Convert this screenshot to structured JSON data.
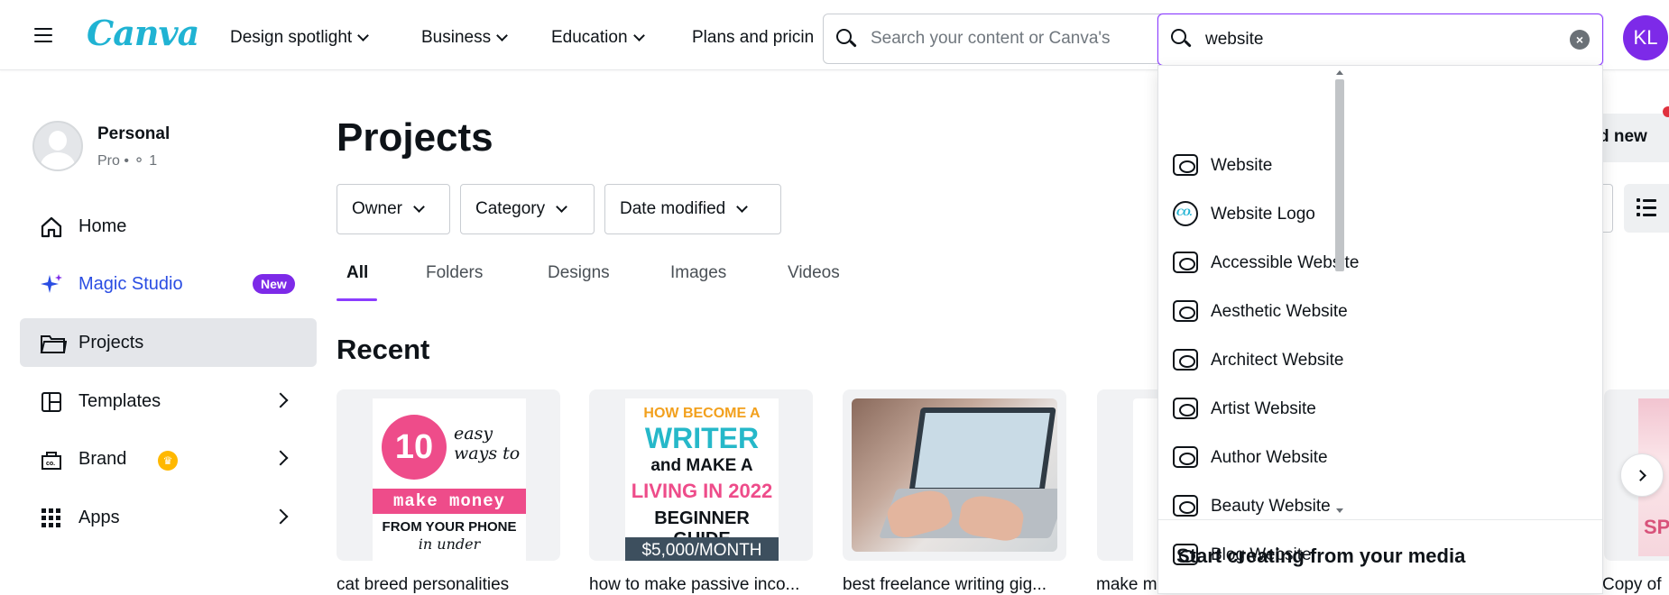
{
  "header": {
    "logo": "Canva",
    "nav": [
      {
        "label": "Design spotlight"
      },
      {
        "label": "Business"
      },
      {
        "label": "Education"
      },
      {
        "label": "Plans and pricin"
      }
    ],
    "search_placeholder": "Search your content or Canva's",
    "search_value": "website",
    "avatar_initials": "KL"
  },
  "sidebar": {
    "account_name": "Personal",
    "account_plan": "Pro • ",
    "account_members": "1",
    "items": [
      {
        "label": "Home",
        "icon": "home-icon"
      },
      {
        "label": "Magic Studio",
        "icon": "sparkle-icon",
        "badge": "New"
      },
      {
        "label": "Projects",
        "icon": "folder-icon",
        "active": true
      },
      {
        "label": "Templates",
        "icon": "templates-icon"
      },
      {
        "label": "Brand",
        "icon": "brand-icon"
      },
      {
        "label": "Apps",
        "icon": "apps-grid-icon"
      }
    ]
  },
  "main": {
    "title": "Projects",
    "filters": [
      {
        "label": "Owner"
      },
      {
        "label": "Category"
      },
      {
        "label": "Date modified"
      }
    ],
    "tabs": [
      {
        "label": "All",
        "active": true
      },
      {
        "label": "Folders"
      },
      {
        "label": "Designs"
      },
      {
        "label": "Images"
      },
      {
        "label": "Videos"
      }
    ],
    "section_title": "Recent",
    "cards": [
      {
        "title": "cat breed personalities",
        "thumb": {
          "num": "10",
          "script": "easy ways to",
          "bar": "make money",
          "line": "FROM YOUR PHONE",
          "under": "in under"
        }
      },
      {
        "title": "how to make passive inco...",
        "thumb": {
          "l1": "HOW BECOME A",
          "l2": "WRITER",
          "l3": "and MAKE A",
          "l4": "LIVING IN 2022",
          "l5": "BEGINNER GUIDE",
          "bar": "$5,000/MONTH"
        }
      },
      {
        "title": "best freelance writing gig..."
      },
      {
        "title": "make m"
      },
      {
        "title": "Copy of",
        "thumb_text": "SP"
      }
    ],
    "add_new_label": "d new"
  },
  "dropdown": {
    "suggestions": [
      {
        "label": "Website",
        "icon": "website-icon"
      },
      {
        "label": "Website Logo",
        "icon": "logo-icon"
      },
      {
        "label": "Accessible Website",
        "icon": "website-icon"
      },
      {
        "label": "Aesthetic Website",
        "icon": "website-icon"
      },
      {
        "label": "Architect Website",
        "icon": "website-icon"
      },
      {
        "label": "Artist Website",
        "icon": "website-icon"
      },
      {
        "label": "Author Website",
        "icon": "website-icon"
      },
      {
        "label": "Beauty Website",
        "icon": "website-icon"
      },
      {
        "label": "Blog Website",
        "icon": "website-icon"
      }
    ],
    "logo_icon_text": "CO.",
    "section_title": "Start creating from your media"
  },
  "colors": {
    "brand_accent": "#8b3dff",
    "avatar_bg": "#7d2ae8",
    "logo": "#20b3d3",
    "magic_studio": "#2a4de3"
  }
}
